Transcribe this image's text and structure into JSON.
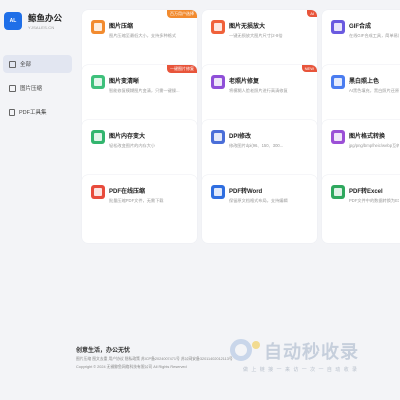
{
  "brand": {
    "mark": "AL",
    "name": "鲸鱼办公",
    "subtitle": "YJSALES.CN",
    "color": "#1f6fe8"
  },
  "nav": [
    {
      "label": "全部",
      "icon": "home-icon",
      "active": true
    },
    {
      "label": "图片压缩",
      "icon": "image-icon",
      "active": false
    },
    {
      "label": "PDF工具集",
      "icon": "pdf-icon",
      "active": false
    }
  ],
  "cards": [
    {
      "title": "图片压缩",
      "desc": "图片压缩至最低大小，支持多种格式",
      "icon": "image-compress-icon",
      "color": "#f28b2f",
      "badge": "百万用户选择"
    },
    {
      "title": "图片无损放大",
      "desc": "一键无损放大图片尺寸(2-8倍",
      "icon": "image-enlarge-icon",
      "color": "#f0613a",
      "badge": "AI"
    },
    {
      "title": "GIF合成",
      "desc": "在线GIF合成工具，简单易用",
      "icon": "gif-icon",
      "color": "#6a5ae0",
      "badge": ""
    },
    {
      "title": "图片变清晰",
      "desc": "智能修复模糊图片变清，只需一键操...",
      "icon": "image-sharpen-icon",
      "color": "#3ec07b",
      "badge": "一键图片修复"
    },
    {
      "title": "老照片修复",
      "desc": "将模糊人脸老照片进行高清修复",
      "icon": "photo-restore-icon",
      "color": "#8f4fd8",
      "badge": "NEW"
    },
    {
      "title": "黑白照上色",
      "desc": "AI黑色填充，黑白照片还原彩色",
      "icon": "colorize-icon",
      "color": "#4a7cf0",
      "badge": ""
    },
    {
      "title": "图片内存变大",
      "desc": "轻松改变图片的内存大小",
      "icon": "image-size-icon",
      "color": "#32b56e",
      "badge": ""
    },
    {
      "title": "DPI修改",
      "desc": "修改图片dpi(96、150、300...",
      "icon": "dpi-icon",
      "color": "#4a6ed8",
      "badge": ""
    },
    {
      "title": "图片格式转换",
      "desc": "jpg/png/bmp/heic/webp互转",
      "icon": "format-convert-icon",
      "color": "#9b4fd6",
      "badge": ""
    },
    {
      "title": "PDF在线压缩",
      "desc": "批量压缩PDF文件，无需下载",
      "icon": "pdf-compress-icon",
      "color": "#e84b3c",
      "badge": ""
    },
    {
      "title": "PDF转Word",
      "desc": "保留原文档格式布局，支持编辑",
      "icon": "pdf-to-word-icon",
      "color": "#2f6ee0",
      "badge": ""
    },
    {
      "title": "PDF转Excel",
      "desc": "PDF文件中的数据转换为EXCEL",
      "icon": "pdf-to-excel-icon",
      "color": "#2fa85e",
      "badge": ""
    }
  ],
  "footer": {
    "slogan": "创意生活，办公无忧",
    "links": "图片压缩 图文去重 用户协议 隐私政策 苏ICP备2024007471号 苏公网安备32011402012113号",
    "copyright": "Copyright © 2024 无锡鲸鱼网络科技有限公司 All Rights Reserved"
  },
  "watermark": {
    "text": "自动秒收录",
    "sub": "做 上 链 接 一 来 访 一 次 一 自 动 收 录"
  }
}
